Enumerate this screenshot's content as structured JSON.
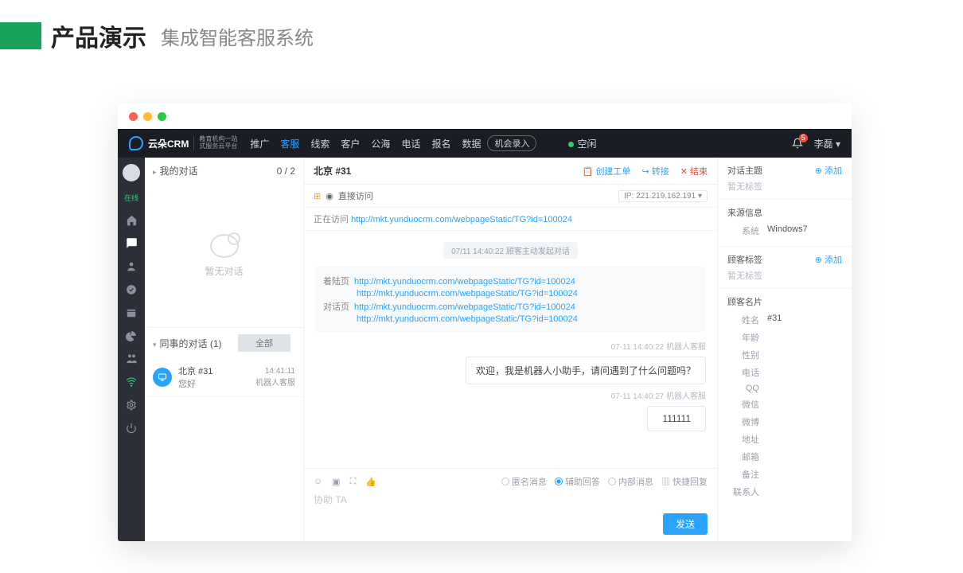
{
  "page": {
    "title_main": "产品演示",
    "title_sub": "集成智能客服系统"
  },
  "nav": {
    "brand": "云朵CRM",
    "brand_sub1": "教育机构一站",
    "brand_sub2": "式服务云平台",
    "items": [
      "推广",
      "客服",
      "线索",
      "客户",
      "公海",
      "电话",
      "报名",
      "数据"
    ],
    "active_index": 1,
    "record_btn": "机会录入",
    "status": "空闲",
    "badge": "5",
    "user": "李磊"
  },
  "rail": {
    "status_label": "在线"
  },
  "left": {
    "mine_title": "我的对话",
    "mine_count": "0 / 2",
    "empty": "暂无对话",
    "colleague_title": "同事的对话  (1)",
    "all_btn": "全部",
    "item": {
      "name": "北京  #31",
      "msg": "您好",
      "time": "14:41:11",
      "src": "机器人客服"
    }
  },
  "center": {
    "title": "北京 #31",
    "actions": {
      "ticket": "创建工单",
      "transfer": "转接",
      "end": "结束"
    },
    "access_label": "直接访问",
    "visiting_label": "正在访问",
    "visiting_url": "http://mkt.yunduocrm.com/webpageStatic/TG?id=100024",
    "ip_label": "IP:",
    "ip": "221.219.162.191",
    "sys_chip": "07/11 14:40:22   顾客主动发起对话",
    "link_block": {
      "land_lbl": "着陆页",
      "land1": "http://mkt.yunduocrm.com/webpageStatic/TG?id=100024",
      "land2": "http://mkt.yunduocrm.com/webpageStatic/TG?id=100024",
      "chat_lbl": "对话页",
      "chat1": "http://mkt.yunduocrm.com/webpageStatic/TG?id=100024",
      "chat2": "http://mkt.yunduocrm.com/webpageStatic/TG?id=100024"
    },
    "meta1": "07-11 14:40:22   机器人客服",
    "bubble1": "欢迎，我是机器人小助手，请问遇到了什么问题吗？",
    "meta2": "07-11 14:40:27   机器人客服",
    "bubble2": "111111",
    "compose": {
      "opts": {
        "anon": "匿名消息",
        "assist": "辅助回答",
        "internal": "内部消息",
        "quick": "快捷回复"
      },
      "placeholder": "协助 TA",
      "send": "发送"
    }
  },
  "right": {
    "topic_title": "对话主题",
    "add": "添加",
    "no_tag": "暂无标签",
    "source_title": "来源信息",
    "sys_k": "系统",
    "sys_v": "Windows7",
    "tags_title": "顾客标签",
    "card_title": "顾客名片",
    "card": {
      "name_k": "姓名",
      "name_v": "#31",
      "age_k": "年龄",
      "sex_k": "性别",
      "phone_k": "电话",
      "qq_k": "QQ",
      "wechat_k": "微信",
      "weibo_k": "微博",
      "addr_k": "地址",
      "mail_k": "邮箱",
      "note_k": "备注",
      "contact_k": "联系人"
    }
  }
}
